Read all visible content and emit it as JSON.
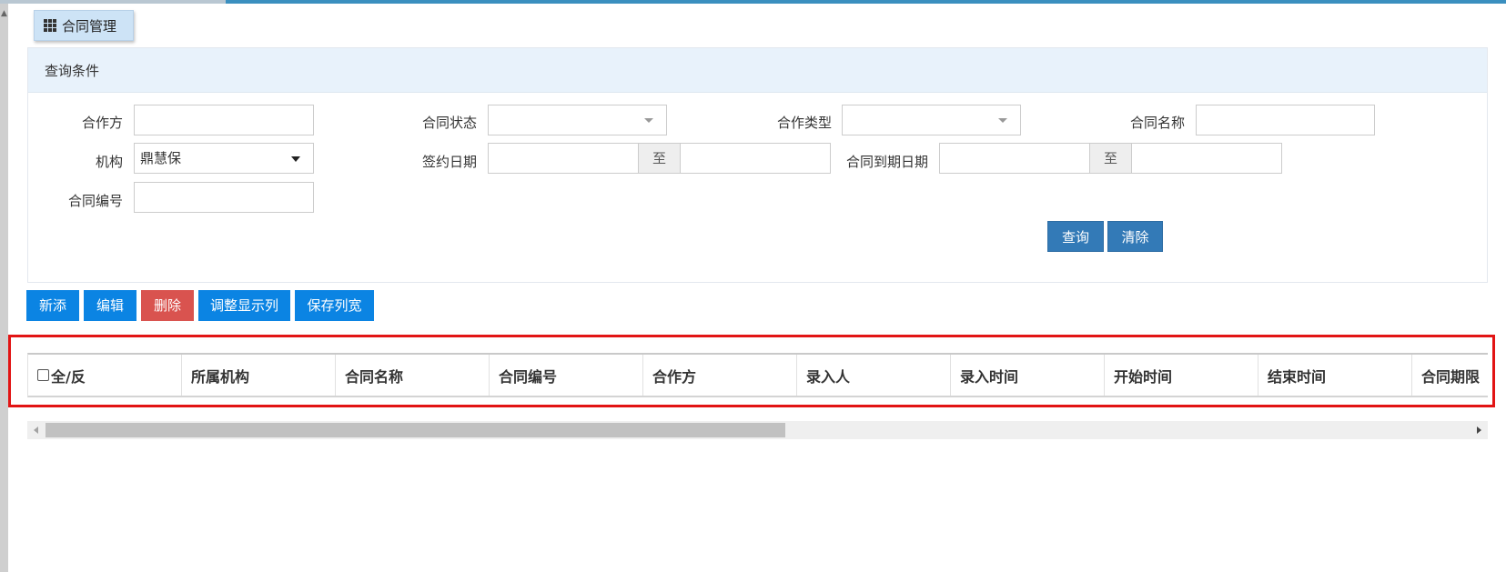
{
  "title_tab": {
    "icon": "grid-icon",
    "label": "合同管理"
  },
  "query_panel": {
    "header": "查询条件",
    "fields": {
      "partner_label": "合作方",
      "partner_value": "",
      "contract_status_label": "合同状态",
      "contract_status_value": "",
      "cooperation_type_label": "合作类型",
      "cooperation_type_value": "",
      "contract_name_label": "合同名称",
      "contract_name_value": "",
      "org_label": "机构",
      "org_value": "鼎慧保",
      "sign_date_label": "签约日期",
      "sign_date_to": "至",
      "expire_date_label": "合同到期日期",
      "expire_date_to": "至",
      "contract_no_label": "合同编号",
      "contract_no_value": ""
    },
    "buttons": {
      "query": "查询",
      "clear": "清除"
    }
  },
  "toolbar": {
    "add": "新添",
    "edit": "编辑",
    "delete": "删除",
    "adjust_columns": "调整显示列",
    "save_width": "保存列宽"
  },
  "table": {
    "select_all_label": "全/反",
    "columns": [
      "所属机构",
      "合同名称",
      "合同编号",
      "合作方",
      "录入人",
      "录入时间",
      "开始时间",
      "结束时间",
      "合同期限"
    ]
  },
  "colors": {
    "primary": "#337ab7",
    "toolbar_blue": "#0b84e3",
    "danger": "#d9534f",
    "highlight_frame": "#e21414",
    "panel_header_bg": "#e8f2fb"
  }
}
